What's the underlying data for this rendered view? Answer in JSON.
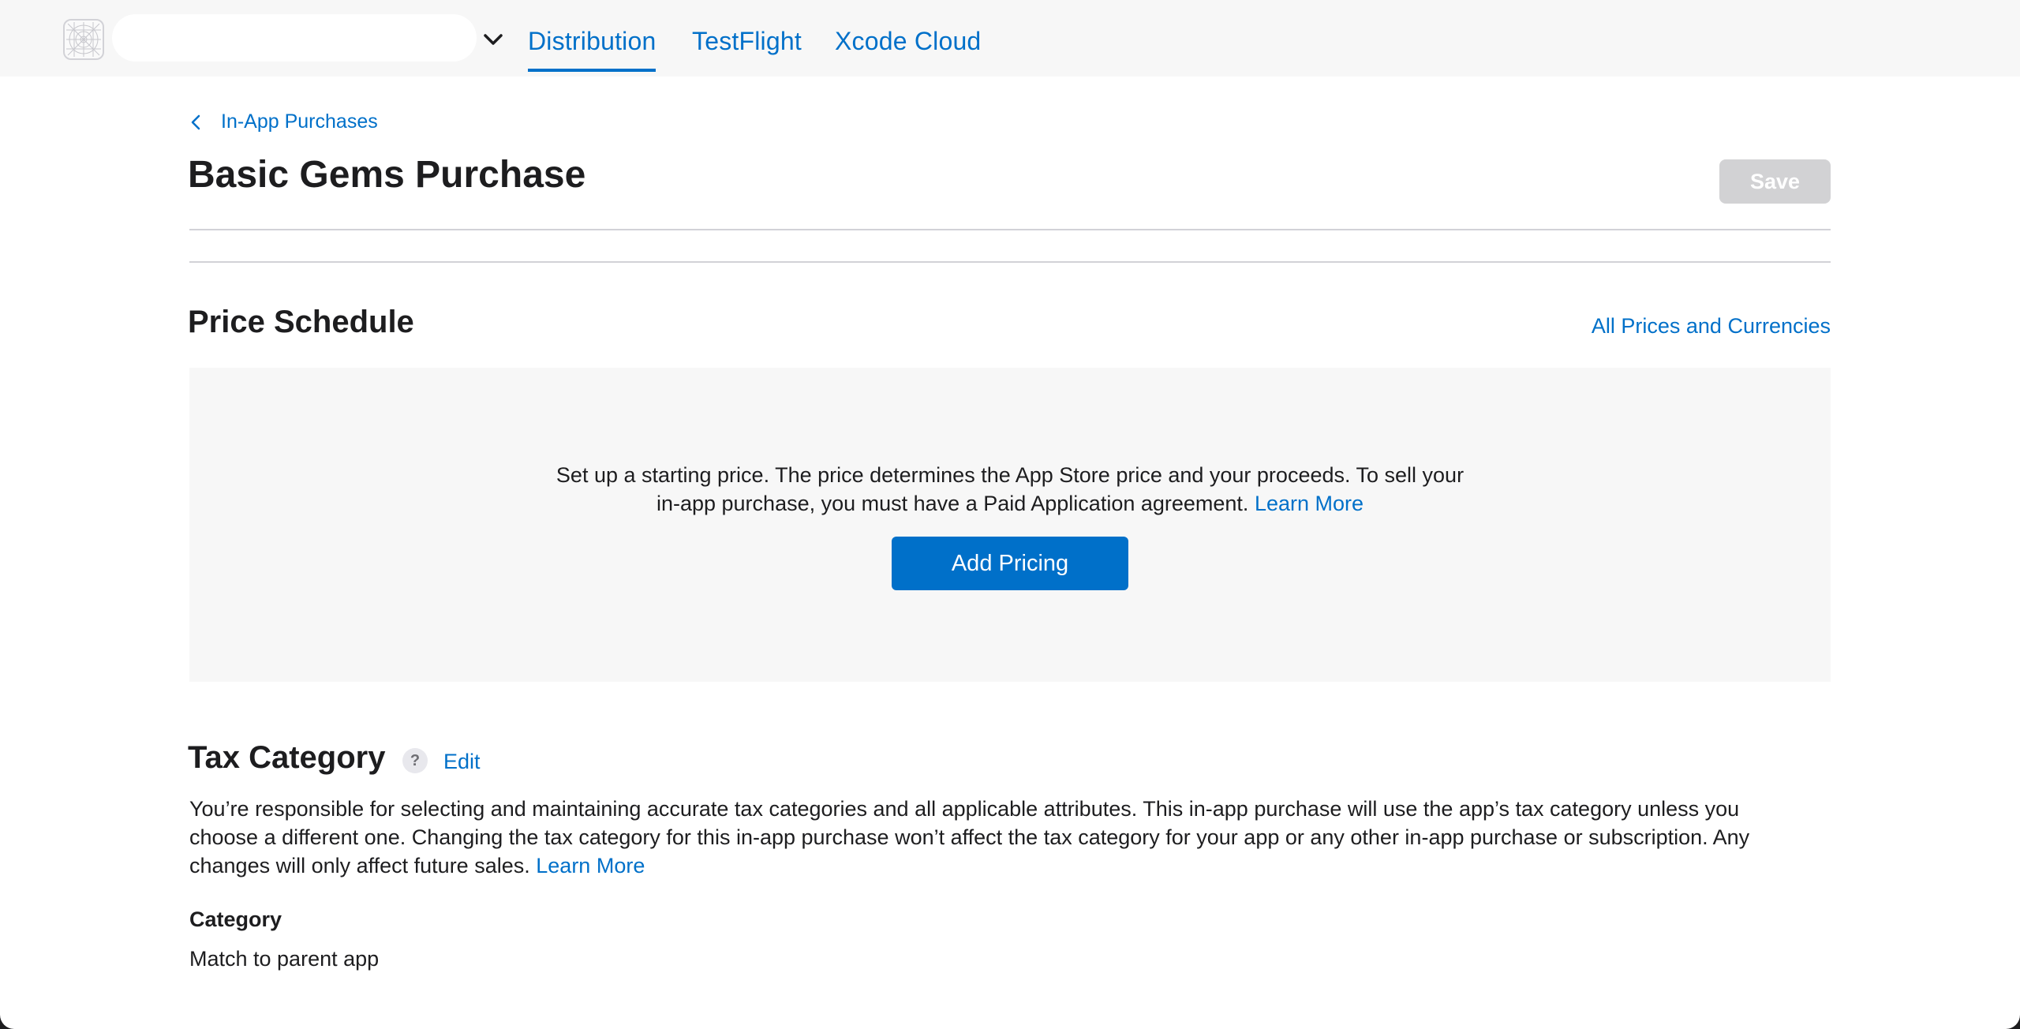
{
  "nav": {
    "tabs": [
      {
        "label": "Distribution",
        "active": true
      },
      {
        "label": "TestFlight",
        "active": false
      },
      {
        "label": "Xcode Cloud",
        "active": false
      }
    ]
  },
  "breadcrumb": {
    "back_label": "In-App Purchases"
  },
  "page": {
    "title": "Basic Gems Purchase",
    "save_label": "Save"
  },
  "price_schedule": {
    "title": "Price Schedule",
    "all_prices_link": "All Prices and Currencies",
    "line1": "Set up a starting price. The price determines the App Store price and your proceeds. To sell your",
    "line2": "in-app purchase, you must have a Paid Application agreement.",
    "learn_more": "Learn More",
    "add_pricing_label": "Add Pricing"
  },
  "tax_category": {
    "title": "Tax Category",
    "help_glyph": "?",
    "edit_label": "Edit",
    "line1": "You’re responsible for selecting and maintaining accurate tax categories and all applicable attributes. This in-app purchase will use the app’s tax category unless you",
    "line2": "choose a different one. Changing the tax category for this in-app purchase won’t affect the tax category for your app or any other in-app purchase or subscription. Any",
    "line3": "changes will only affect future sales.",
    "learn_more": "Learn More",
    "category_label": "Category",
    "category_value": "Match to parent app"
  },
  "colors": {
    "accent": "#0070c9",
    "disabled_button": "#d2d2d4",
    "panel_background": "#f7f7f7",
    "divider": "#d2d2d7"
  },
  "icons": [
    "app-placeholder-icon",
    "chevron-down-icon",
    "chevron-left-icon",
    "help-icon"
  ]
}
